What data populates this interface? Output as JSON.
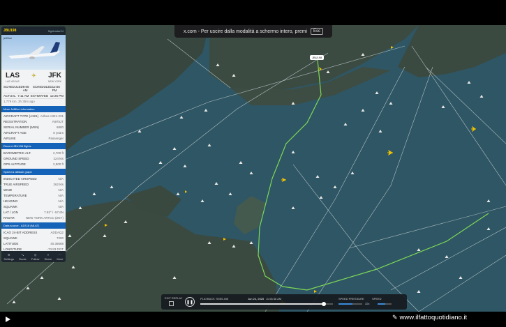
{
  "toast": {
    "text": "x.com - Per uscire dalla modalità a schermo intero, premi",
    "key": "Esc"
  },
  "flight": {
    "callsign": "JBU198",
    "subtitle": "jetBlue",
    "tag": "flightradar24",
    "origin": "LAS",
    "origin_city": "LAS VEGAS",
    "destination": "JFK",
    "destination_city": "NEW YORK",
    "times": [
      {
        "label": "SCHEDULED",
        "value": "9:05 AM",
        "label2": "SCHEDULED",
        "value2": "12:56 PM"
      },
      {
        "label": "ACTUAL",
        "value": "7:11 AM",
        "label2": "ESTIMATED",
        "value2": "12:25 PM"
      }
    ],
    "progress_note": "1,779 km, 3h 35m ago"
  },
  "sections": [
    {
      "title": "More JetBlue information",
      "color": "blue",
      "rows": [
        {
          "k": "AIRCRAFT TYPE (A321)",
          "v": "Airbus A321-231"
        },
        {
          "k": "REGISTRATION",
          "v": "N975JT"
        },
        {
          "k": "SERIAL NUMBER (MSN)",
          "v": "6800"
        },
        {
          "k": "AIRCRAFT AGE",
          "v": "5 years"
        },
        {
          "k": "AIRLINE",
          "v": "Passenger"
        }
      ]
    },
    {
      "title": "Recent JBU198 flights",
      "color": "blue",
      "rows": [
        {
          "k": "BAROMETRIC ALT.",
          "v": "2,700 ft"
        },
        {
          "k": "GROUND SPEED",
          "v": "224 kts"
        },
        {
          "k": "GPS ALTITUDE",
          "v": "2,500 ft"
        }
      ]
    },
    {
      "title": "Speed & altitude graph",
      "color": "blue",
      "rows": [
        {
          "k": "INDICATED AIRSPEED",
          "v": "N/A"
        },
        {
          "k": "TRUE AIRSPEED",
          "v": "262 kts"
        },
        {
          "k": "WIND",
          "v": "N/A"
        },
        {
          "k": "TEMPERATURE",
          "v": "N/A"
        },
        {
          "k": "HEADING",
          "v": "N/A"
        },
        {
          "k": "SQUAWK",
          "v": "N/A"
        },
        {
          "k": "LAT / LON",
          "v": "7.93° / -57.6N"
        },
        {
          "k": "RADAR",
          "v": "NEW YORK ARTCC (ZNY)"
        }
      ]
    },
    {
      "title": "Data source - ADS-B (MLAT)",
      "color": "blue",
      "rows": [
        {
          "k": "ICAO 24-BIT ADDRESS",
          "v": "ADDAQ2"
        },
        {
          "k": "SQUAWK",
          "v": "7200"
        },
        {
          "k": "LATITUDE",
          "v": "40.36668"
        },
        {
          "k": "LONGITUDE",
          "v": "-73.83 DOT"
        }
      ]
    },
    {
      "title": "Refresh • Compare",
      "color": "orange",
      "rows": []
    }
  ],
  "footer": [
    "Settings",
    "Route",
    "Follow",
    "Share",
    "More"
  ],
  "playback": {
    "exit_label": "EXIT REPLAY",
    "timeline_label": "PLAYBACK TIMELINE",
    "date": "Jun 24, 2025",
    "time": "11:56:48 AM",
    "progress": 0.93,
    "speed_label": "SPEED PRESSURE",
    "speed_value": "32x",
    "volume_label": "SPEED",
    "speed_fill": 0.6,
    "volume_fill": 0.55
  },
  "highlight_label": "JBU198",
  "watermark": "www.ilfattoquotidiano.it",
  "colors": {
    "water": "#2f5664",
    "land": "#3a4a43",
    "track": "#7ed957",
    "aircraft": "#f2c200"
  }
}
